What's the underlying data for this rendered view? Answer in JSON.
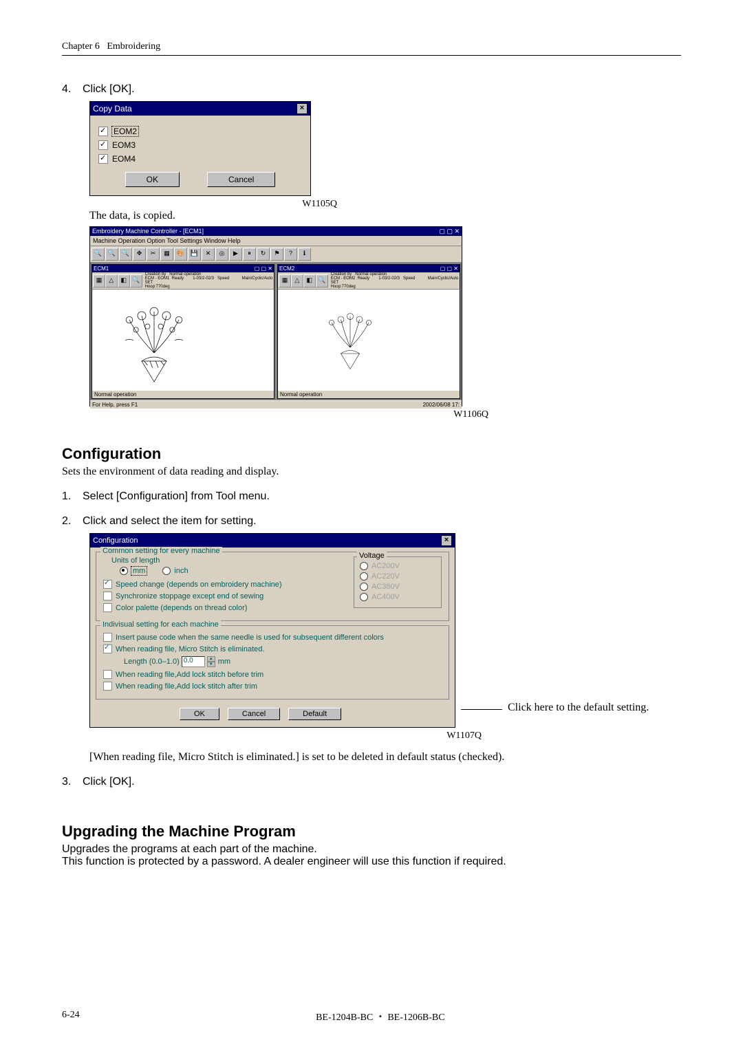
{
  "header": {
    "chapter": "Chapter 6",
    "title": "Embroidering"
  },
  "step4": {
    "num": "4.",
    "text": "Click [OK]."
  },
  "dialog1": {
    "title": "Copy Data",
    "items": [
      "EOM2",
      "EOM3",
      "EOM4"
    ],
    "ok": "OK",
    "cancel": "Cancel",
    "imglabel": "W1105Q"
  },
  "copied_text": "The data, is copied.",
  "dialog2": {
    "title": "Embroidery Machine Controller - [ECM1]",
    "menu": "Machine  Operation  Option  Tool  Settings  Window  Help",
    "child_info_left": "Creation by   Normal operation\nECM - EOM1  Ready        1-03/2-02/3   Speed           Main/Cyclic/Auto SET\nHoop:770deg",
    "child_info_right": "Creation by   Normal operation\nECM - EOM2  Ready        1-03/2-02/3   Speed           Main/Cyclic/Auto SET\nHoop:770deg",
    "status_left": "Normal operation",
    "status_help": "For Help, press F1",
    "status_right": "2002/06/08  17:",
    "imglabel": "W1106Q"
  },
  "config_section": {
    "heading": "Configuration",
    "desc": "Sets the environment of data reading and display."
  },
  "step1": {
    "num": "1.",
    "text": "Select [Configuration] from Tool menu."
  },
  "step2": {
    "num": "2.",
    "text": "Click and select the item for setting."
  },
  "dialog3": {
    "title": "Configuration",
    "group_common": "Common setting for every machine",
    "units_label": "Units of length",
    "unit_mm": "mm",
    "unit_inch": "inch",
    "voltage_label": "Voltage",
    "voltage_opts": [
      "AC200V",
      "AC220V",
      "AC380V",
      "AC400V"
    ],
    "opt_speed": "Speed change (depends on embroidery machine)",
    "opt_sync": "Synchronize stoppage except end of sewing",
    "opt_palette": "Color palette (depends on thread color)",
    "group_indiv": "Indivisual setting for each machine",
    "opt_pause": "Insert pause code when the same needle is used for subsequent different colors",
    "opt_micro": "When reading file, Micro Stitch is eliminated.",
    "length_label": "Length (0.0–1.0)",
    "length_val": "0.0",
    "length_unit": "mm",
    "opt_before": "When reading file,Add lock stitch before trim",
    "opt_after": "When reading file,Add lock stitch after trim",
    "ok": "OK",
    "cancel": "Cancel",
    "default": "Default",
    "imglabel": "W1107Q"
  },
  "callout": "Click here to the default setting.",
  "micro_note": "[When reading file, Micro Stitch is eliminated.] is set to be deleted in default status (checked).",
  "step3": {
    "num": "3.",
    "text": "Click [OK]."
  },
  "upgrade_section": {
    "heading": "Upgrading the Machine Program",
    "line1": "Upgrades the programs at each part of the machine.",
    "line2": "This function is protected by a password.   A dealer engineer will use this function if required."
  },
  "footer": {
    "page": "6-24",
    "model": "BE-1204B-BC ・ BE-1206B-BC"
  }
}
